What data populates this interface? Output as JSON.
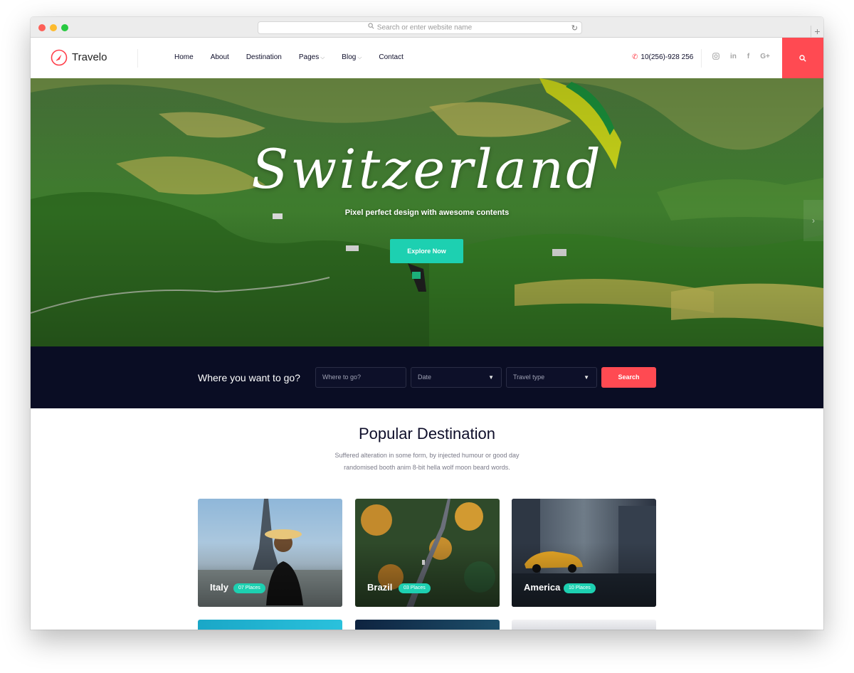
{
  "browser": {
    "url_placeholder": "Search or enter website name",
    "new_tab_symbol": "+"
  },
  "nav": {
    "brand": "Travelo",
    "menu": [
      {
        "label": "Home",
        "has_dropdown": false
      },
      {
        "label": "About",
        "has_dropdown": false
      },
      {
        "label": "Destination",
        "has_dropdown": false
      },
      {
        "label": "Pages",
        "has_dropdown": true
      },
      {
        "label": "Blog",
        "has_dropdown": true
      },
      {
        "label": "Contact",
        "has_dropdown": false
      }
    ],
    "phone": "10(256)-928 256",
    "social_icons": [
      "instagram-icon",
      "linkedin-icon",
      "facebook-icon",
      "google-plus-icon"
    ],
    "accent_color": "#ff4a52"
  },
  "hero": {
    "title": "Switzerland",
    "subtitle": "Pixel perfect design with awesome contents",
    "cta_label": "Explore Now",
    "cta_color": "#1dd0b1",
    "next_arrow": "›"
  },
  "search": {
    "label": "Where you want to go?",
    "where_placeholder": "Where to go?",
    "date_value": "Date",
    "travel_type_value": "Travel type",
    "button_label": "Search"
  },
  "popular": {
    "title": "Popular Destination",
    "description_line1": "Suffered alteration in some form, by injected humour or good day",
    "description_line2": "randomised booth anim 8-bit hella wolf moon beard words.",
    "cards": [
      {
        "name": "Italy",
        "places": "07 Places"
      },
      {
        "name": "Brazil",
        "places": "03 Places"
      },
      {
        "name": "America",
        "places": "10 Places"
      }
    ]
  }
}
